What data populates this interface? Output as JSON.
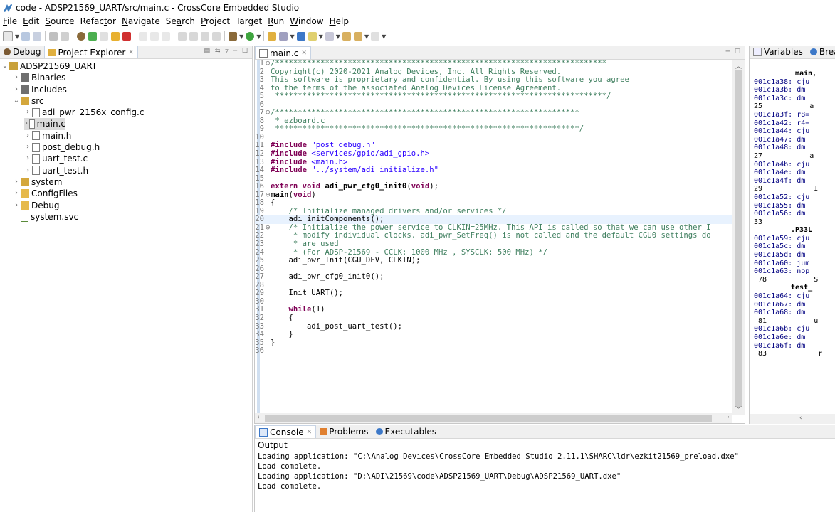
{
  "window": {
    "title": "code - ADSP21569_UART/src/main.c - CrossCore Embedded Studio"
  },
  "menu": [
    {
      "label": "File",
      "mn": "F",
      "rest": "ile"
    },
    {
      "label": "Edit",
      "mn": "E",
      "rest": "dit"
    },
    {
      "label": "Source",
      "mn": "S",
      "rest": "ource"
    },
    {
      "label": "Refactor",
      "pre": "Refac",
      "mn": "t",
      "rest": "or"
    },
    {
      "label": "Navigate",
      "mn": "N",
      "rest": "avigate"
    },
    {
      "label": "Search",
      "pre": "Se",
      "mn": "a",
      "rest": "rch"
    },
    {
      "label": "Project",
      "mn": "P",
      "rest": "roject"
    },
    {
      "label": "Target",
      "pre": "Tar",
      "mn": "g",
      "rest": "et"
    },
    {
      "label": "Run",
      "mn": "R",
      "rest": "un"
    },
    {
      "label": "Window",
      "mn": "W",
      "rest": "indow"
    },
    {
      "label": "Help",
      "mn": "H",
      "rest": "elp"
    }
  ],
  "leftpanel": {
    "tabs": [
      {
        "label": "Debug"
      },
      {
        "label": "Project Explorer"
      }
    ],
    "tree": [
      {
        "label": "ADSP21569_UART",
        "indent": 0,
        "arrow": "⌄",
        "icon": "project-icon",
        "color": "#c9a13a"
      },
      {
        "label": "Binaries",
        "indent": 1,
        "arrow": "›",
        "icon": "binaries-icon",
        "color": "#6f6f6f"
      },
      {
        "label": "Includes",
        "indent": 1,
        "arrow": "›",
        "icon": "includes-icon",
        "color": "#6f6f6f"
      },
      {
        "label": "src",
        "indent": 1,
        "arrow": "⌄",
        "icon": "source-folder-icon",
        "color": "#d4a73c"
      },
      {
        "label": "adi_pwr_2156x_config.c",
        "indent": 2,
        "arrow": "›",
        "icon": "c-file-icon",
        "color": "#7d7d7d"
      },
      {
        "label": "main.c",
        "indent": 2,
        "arrow": "›",
        "icon": "c-file-icon",
        "color": "#7d7d7d",
        "selected": true
      },
      {
        "label": "main.h",
        "indent": 2,
        "arrow": "›",
        "icon": "h-file-icon",
        "color": "#7d7d7d"
      },
      {
        "label": "post_debug.h",
        "indent": 2,
        "arrow": "›",
        "icon": "h-file-icon",
        "color": "#7d7d7d"
      },
      {
        "label": "uart_test.c",
        "indent": 2,
        "arrow": "›",
        "icon": "c-file-icon",
        "color": "#7d7d7d"
      },
      {
        "label": "uart_test.h",
        "indent": 2,
        "arrow": "›",
        "icon": "h-file-icon",
        "color": "#7d7d7d"
      },
      {
        "label": "system",
        "indent": 1,
        "arrow": "›",
        "icon": "source-folder-icon",
        "color": "#d4a73c"
      },
      {
        "label": "ConfigFiles",
        "indent": 1,
        "arrow": "›",
        "icon": "folder-icon",
        "color": "#e6b94a"
      },
      {
        "label": "Debug",
        "indent": 1,
        "arrow": "›",
        "icon": "folder-icon",
        "color": "#e6b94a"
      },
      {
        "label": "system.svc",
        "indent": 1,
        "arrow": "",
        "icon": "svc-file-icon",
        "color": "#5a8a3a"
      }
    ]
  },
  "editor": {
    "tab": "main.c",
    "lines": [
      {
        "n": "1",
        "m": "⊖",
        "cls": "cm",
        "t": "/*************************************************************************"
      },
      {
        "n": "2",
        "m": "",
        "cls": "cm",
        "t": "Copyright(c) 2020-2021 Analog Devices, Inc. All Rights Reserved."
      },
      {
        "n": "3",
        "m": "",
        "cls": "cm",
        "t": "This software is proprietary and confidential. By using this software you agree"
      },
      {
        "n": "4",
        "m": "",
        "cls": "cm",
        "t": "to the terms of the associated Analog Devices License Agreement."
      },
      {
        "n": "5",
        "m": "",
        "cls": "cm",
        "t": " *************************************************************************/"
      },
      {
        "n": "6",
        "m": "",
        "cls": "plain",
        "t": ""
      },
      {
        "n": "7",
        "m": "⊖",
        "cls": "cm",
        "t": "/*******************************************************************"
      },
      {
        "n": "8",
        "m": "",
        "cls": "cm",
        "t": " * ezboard.c"
      },
      {
        "n": "9",
        "m": "",
        "cls": "cm",
        "t": " *******************************************************************/"
      },
      {
        "n": "10",
        "m": "",
        "cls": "plain",
        "t": ""
      },
      {
        "n": "11",
        "m": "",
        "parts": [
          {
            "c": "kw",
            "t": "#include "
          },
          {
            "c": "str",
            "t": "\"post_debug.h\""
          }
        ]
      },
      {
        "n": "12",
        "m": "",
        "parts": [
          {
            "c": "kw",
            "t": "#include "
          },
          {
            "c": "str",
            "t": "<services/gpio/adi_gpio.h>"
          }
        ]
      },
      {
        "n": "13",
        "m": "",
        "parts": [
          {
            "c": "kw",
            "t": "#include "
          },
          {
            "c": "str",
            "t": "<main.h>"
          }
        ]
      },
      {
        "n": "14",
        "m": "",
        "parts": [
          {
            "c": "kw",
            "t": "#include "
          },
          {
            "c": "str",
            "t": "\"../system/adi_initialize.h\""
          }
        ]
      },
      {
        "n": "15",
        "m": "",
        "cls": "plain",
        "t": ""
      },
      {
        "n": "16",
        "m": "",
        "parts": [
          {
            "c": "kw",
            "t": "extern void "
          },
          {
            "c": "fn",
            "t": "adi_pwr_cfg0_init0"
          },
          {
            "c": "plain",
            "t": "("
          },
          {
            "c": "kw",
            "t": "void"
          },
          {
            "c": "plain",
            "t": ");"
          }
        ]
      },
      {
        "n": "17",
        "m": "⊖",
        "parts": [
          {
            "c": "fn",
            "t": "main"
          },
          {
            "c": "plain",
            "t": "("
          },
          {
            "c": "kw",
            "t": "void"
          },
          {
            "c": "plain",
            "t": ")"
          }
        ]
      },
      {
        "n": "18",
        "m": "",
        "cls": "plain",
        "t": "{"
      },
      {
        "n": "19",
        "m": "",
        "cls": "cm",
        "t": "    /* Initialize managed drivers and/or services */"
      },
      {
        "n": "20",
        "m": "",
        "cls": "plain",
        "t": "    adi_initComponents();",
        "hl": true
      },
      {
        "n": "21",
        "m": "⊖",
        "cls": "cm",
        "t": "    /* Initialize the power service to CLKIN=25MHz. This API is called so that we can use other I"
      },
      {
        "n": "22",
        "m": "",
        "cls": "cm",
        "t": "     * modify individual clocks. adi_pwr_SetFreq() is not called and the default CGU0 settings do"
      },
      {
        "n": "23",
        "m": "",
        "cls": "cm",
        "t": "     * are used"
      },
      {
        "n": "24",
        "m": "",
        "cls": "cm",
        "t": "     * (For ADSP-21569 - CCLK: 1000 MHz , SYSCLK: 500 MHz) */"
      },
      {
        "n": "25",
        "m": "",
        "cls": "plain",
        "t": "    adi_pwr_Init(CGU_DEV, CLKIN);"
      },
      {
        "n": "26",
        "m": "",
        "cls": "plain",
        "t": ""
      },
      {
        "n": "27",
        "m": "",
        "cls": "plain",
        "t": "    adi_pwr_cfg0_init0();"
      },
      {
        "n": "28",
        "m": "",
        "cls": "plain",
        "t": ""
      },
      {
        "n": "29",
        "m": "",
        "cls": "plain",
        "t": "    Init_UART();"
      },
      {
        "n": "30",
        "m": "",
        "cls": "plain",
        "t": ""
      },
      {
        "n": "31",
        "m": "",
        "parts": [
          {
            "c": "kw",
            "t": "    while"
          },
          {
            "c": "plain",
            "t": "(1)"
          }
        ]
      },
      {
        "n": "32",
        "m": "",
        "cls": "plain",
        "t": "    {"
      },
      {
        "n": "33",
        "m": "",
        "cls": "plain",
        "t": "        adi_post_uart_test();"
      },
      {
        "n": "34",
        "m": "",
        "cls": "plain",
        "t": "    }"
      },
      {
        "n": "35",
        "m": "",
        "cls": "plain",
        "t": "}"
      },
      {
        "n": "36",
        "m": "",
        "cls": "plain",
        "t": ""
      }
    ]
  },
  "rightpanel": {
    "tabs": [
      {
        "label": "Variables"
      },
      {
        "label": "Breakp"
      }
    ],
    "disasm": [
      {
        "k": "label",
        "t": "main,"
      },
      {
        "k": "row",
        "a": "001c1a38:",
        "i": "cju"
      },
      {
        "k": "row",
        "a": "001c1a3b:",
        "i": "dm"
      },
      {
        "k": "row",
        "a": "001c1a3c:",
        "i": "dm"
      },
      {
        "k": "num",
        "t": "25           a"
      },
      {
        "k": "row",
        "a": "001c1a3f:",
        "i": "r8="
      },
      {
        "k": "row",
        "a": "001c1a42:",
        "i": "r4="
      },
      {
        "k": "row",
        "a": "001c1a44:",
        "i": "cju"
      },
      {
        "k": "row",
        "a": "001c1a47:",
        "i": "dm"
      },
      {
        "k": "row",
        "a": "001c1a48:",
        "i": "dm"
      },
      {
        "k": "num",
        "t": "27           a"
      },
      {
        "k": "row",
        "a": "001c1a4b:",
        "i": "cju"
      },
      {
        "k": "row",
        "a": "001c1a4e:",
        "i": "dm"
      },
      {
        "k": "row",
        "a": "001c1a4f:",
        "i": "dm"
      },
      {
        "k": "num",
        "t": "29            I"
      },
      {
        "k": "row",
        "a": "001c1a52:",
        "i": "cju"
      },
      {
        "k": "row",
        "a": "001c1a55:",
        "i": "dm"
      },
      {
        "k": "row",
        "a": "001c1a56:",
        "i": "dm"
      },
      {
        "k": "num",
        "t": "33"
      },
      {
        "k": "label",
        "t": ".P33L"
      },
      {
        "k": "row",
        "a": "001c1a59:",
        "i": "cju"
      },
      {
        "k": "row",
        "a": "001c1a5c:",
        "i": "dm"
      },
      {
        "k": "row",
        "a": "001c1a5d:",
        "i": "dm"
      },
      {
        "k": "row",
        "a": "001c1a60:",
        "i": "jum"
      },
      {
        "k": "row",
        "a": "001c1a63:",
        "i": "nop"
      },
      {
        "k": "num",
        "t": " 78           S"
      },
      {
        "k": "label",
        "t": "test_"
      },
      {
        "k": "row",
        "a": "001c1a64:",
        "i": "cju"
      },
      {
        "k": "row",
        "a": "001c1a67:",
        "i": "dm"
      },
      {
        "k": "row",
        "a": "001c1a68:",
        "i": "dm"
      },
      {
        "k": "num",
        "t": " 81           u"
      },
      {
        "k": "row",
        "a": "001c1a6b:",
        "i": "cju"
      },
      {
        "k": "row",
        "a": "001c1a6e:",
        "i": "dm"
      },
      {
        "k": "row",
        "a": "001c1a6f:",
        "i": "dm"
      },
      {
        "k": "num",
        "t": " 83            r"
      }
    ]
  },
  "console": {
    "tabs": [
      {
        "label": "Console"
      },
      {
        "label": "Problems"
      },
      {
        "label": "Executables"
      }
    ],
    "output_label": "Output",
    "lines": [
      "Loading application: \"C:\\Analog Devices\\CrossCore Embedded Studio 2.11.1\\SHARC\\ldr\\ezkit21569_preload.dxe\"",
      "Load complete.",
      "Loading application: \"D:\\ADI\\21569\\code\\ADSP21569_UART\\Debug\\ADSP21569_UART.dxe\"",
      "Load complete."
    ]
  },
  "colors": {
    "accent": "#3c78c8",
    "selection": "#dcdcdc",
    "line_highlight": "#e8f2fe"
  }
}
